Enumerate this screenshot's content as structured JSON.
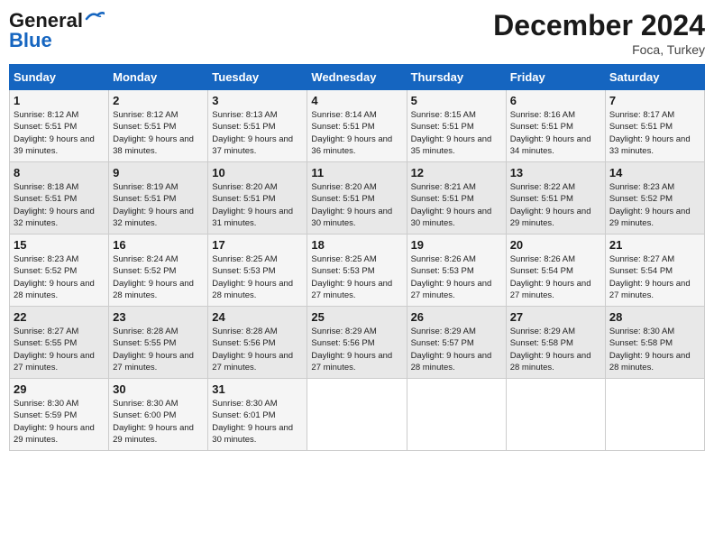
{
  "header": {
    "logo_general": "General",
    "logo_blue": "Blue",
    "month_title": "December 2024",
    "location": "Foca, Turkey"
  },
  "weekdays": [
    "Sunday",
    "Monday",
    "Tuesday",
    "Wednesday",
    "Thursday",
    "Friday",
    "Saturday"
  ],
  "weeks": [
    [
      {
        "day": "1",
        "sunrise": "Sunrise: 8:12 AM",
        "sunset": "Sunset: 5:51 PM",
        "daylight": "Daylight: 9 hours and 39 minutes."
      },
      {
        "day": "2",
        "sunrise": "Sunrise: 8:12 AM",
        "sunset": "Sunset: 5:51 PM",
        "daylight": "Daylight: 9 hours and 38 minutes."
      },
      {
        "day": "3",
        "sunrise": "Sunrise: 8:13 AM",
        "sunset": "Sunset: 5:51 PM",
        "daylight": "Daylight: 9 hours and 37 minutes."
      },
      {
        "day": "4",
        "sunrise": "Sunrise: 8:14 AM",
        "sunset": "Sunset: 5:51 PM",
        "daylight": "Daylight: 9 hours and 36 minutes."
      },
      {
        "day": "5",
        "sunrise": "Sunrise: 8:15 AM",
        "sunset": "Sunset: 5:51 PM",
        "daylight": "Daylight: 9 hours and 35 minutes."
      },
      {
        "day": "6",
        "sunrise": "Sunrise: 8:16 AM",
        "sunset": "Sunset: 5:51 PM",
        "daylight": "Daylight: 9 hours and 34 minutes."
      },
      {
        "day": "7",
        "sunrise": "Sunrise: 8:17 AM",
        "sunset": "Sunset: 5:51 PM",
        "daylight": "Daylight: 9 hours and 33 minutes."
      }
    ],
    [
      {
        "day": "8",
        "sunrise": "Sunrise: 8:18 AM",
        "sunset": "Sunset: 5:51 PM",
        "daylight": "Daylight: 9 hours and 32 minutes."
      },
      {
        "day": "9",
        "sunrise": "Sunrise: 8:19 AM",
        "sunset": "Sunset: 5:51 PM",
        "daylight": "Daylight: 9 hours and 32 minutes."
      },
      {
        "day": "10",
        "sunrise": "Sunrise: 8:20 AM",
        "sunset": "Sunset: 5:51 PM",
        "daylight": "Daylight: 9 hours and 31 minutes."
      },
      {
        "day": "11",
        "sunrise": "Sunrise: 8:20 AM",
        "sunset": "Sunset: 5:51 PM",
        "daylight": "Daylight: 9 hours and 30 minutes."
      },
      {
        "day": "12",
        "sunrise": "Sunrise: 8:21 AM",
        "sunset": "Sunset: 5:51 PM",
        "daylight": "Daylight: 9 hours and 30 minutes."
      },
      {
        "day": "13",
        "sunrise": "Sunrise: 8:22 AM",
        "sunset": "Sunset: 5:51 PM",
        "daylight": "Daylight: 9 hours and 29 minutes."
      },
      {
        "day": "14",
        "sunrise": "Sunrise: 8:23 AM",
        "sunset": "Sunset: 5:52 PM",
        "daylight": "Daylight: 9 hours and 29 minutes."
      }
    ],
    [
      {
        "day": "15",
        "sunrise": "Sunrise: 8:23 AM",
        "sunset": "Sunset: 5:52 PM",
        "daylight": "Daylight: 9 hours and 28 minutes."
      },
      {
        "day": "16",
        "sunrise": "Sunrise: 8:24 AM",
        "sunset": "Sunset: 5:52 PM",
        "daylight": "Daylight: 9 hours and 28 minutes."
      },
      {
        "day": "17",
        "sunrise": "Sunrise: 8:25 AM",
        "sunset": "Sunset: 5:53 PM",
        "daylight": "Daylight: 9 hours and 28 minutes."
      },
      {
        "day": "18",
        "sunrise": "Sunrise: 8:25 AM",
        "sunset": "Sunset: 5:53 PM",
        "daylight": "Daylight: 9 hours and 27 minutes."
      },
      {
        "day": "19",
        "sunrise": "Sunrise: 8:26 AM",
        "sunset": "Sunset: 5:53 PM",
        "daylight": "Daylight: 9 hours and 27 minutes."
      },
      {
        "day": "20",
        "sunrise": "Sunrise: 8:26 AM",
        "sunset": "Sunset: 5:54 PM",
        "daylight": "Daylight: 9 hours and 27 minutes."
      },
      {
        "day": "21",
        "sunrise": "Sunrise: 8:27 AM",
        "sunset": "Sunset: 5:54 PM",
        "daylight": "Daylight: 9 hours and 27 minutes."
      }
    ],
    [
      {
        "day": "22",
        "sunrise": "Sunrise: 8:27 AM",
        "sunset": "Sunset: 5:55 PM",
        "daylight": "Daylight: 9 hours and 27 minutes."
      },
      {
        "day": "23",
        "sunrise": "Sunrise: 8:28 AM",
        "sunset": "Sunset: 5:55 PM",
        "daylight": "Daylight: 9 hours and 27 minutes."
      },
      {
        "day": "24",
        "sunrise": "Sunrise: 8:28 AM",
        "sunset": "Sunset: 5:56 PM",
        "daylight": "Daylight: 9 hours and 27 minutes."
      },
      {
        "day": "25",
        "sunrise": "Sunrise: 8:29 AM",
        "sunset": "Sunset: 5:56 PM",
        "daylight": "Daylight: 9 hours and 27 minutes."
      },
      {
        "day": "26",
        "sunrise": "Sunrise: 8:29 AM",
        "sunset": "Sunset: 5:57 PM",
        "daylight": "Daylight: 9 hours and 28 minutes."
      },
      {
        "day": "27",
        "sunrise": "Sunrise: 8:29 AM",
        "sunset": "Sunset: 5:58 PM",
        "daylight": "Daylight: 9 hours and 28 minutes."
      },
      {
        "day": "28",
        "sunrise": "Sunrise: 8:30 AM",
        "sunset": "Sunset: 5:58 PM",
        "daylight": "Daylight: 9 hours and 28 minutes."
      }
    ],
    [
      {
        "day": "29",
        "sunrise": "Sunrise: 8:30 AM",
        "sunset": "Sunset: 5:59 PM",
        "daylight": "Daylight: 9 hours and 29 minutes."
      },
      {
        "day": "30",
        "sunrise": "Sunrise: 8:30 AM",
        "sunset": "Sunset: 6:00 PM",
        "daylight": "Daylight: 9 hours and 29 minutes."
      },
      {
        "day": "31",
        "sunrise": "Sunrise: 8:30 AM",
        "sunset": "Sunset: 6:01 PM",
        "daylight": "Daylight: 9 hours and 30 minutes."
      },
      null,
      null,
      null,
      null
    ]
  ]
}
